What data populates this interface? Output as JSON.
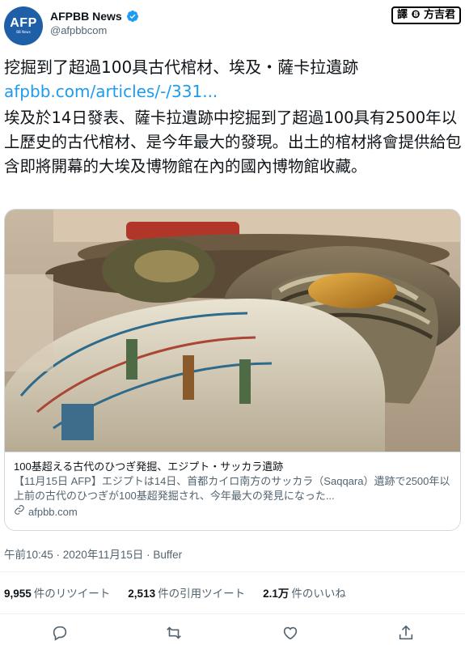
{
  "account": {
    "avatar_logo": "AFP",
    "avatar_sub": "BB News",
    "name": "AFPBB News",
    "handle": "@afpbbcom"
  },
  "badge": "譯 ❽ 方吉君",
  "tweet": {
    "title": "挖掘到了超過100具古代棺材、埃及・薩卡拉遺跡",
    "link": "afpbb.com/articles/-/331...",
    "body": "埃及於14日發表、薩卡拉遺跡中挖掘到了超過100具有2500年以上歷史的古代棺材、是今年最大的發現。出土的棺材將會提供給包含即將開幕的大埃及博物館在內的國內博物館收藏。"
  },
  "card": {
    "title": "100基超える古代のひつぎ発掘、エジプト・サッカラ遺跡",
    "description": "【11月15日 AFP】エジプトは14日、首都カイロ南方のサッカラ（Saqqara）遺跡で2500年以上前の古代のひつぎが100基超発掘され、今年最大の発見になった...",
    "domain": "afpbb.com"
  },
  "meta": "午前10:45 · 2020年11月15日 · Buffer",
  "stats": [
    {
      "count": "9,955",
      "label": "件のリツイート"
    },
    {
      "count": "2,513",
      "label": "件の引用ツイート"
    },
    {
      "count": "2.1万",
      "label": "件のいいね"
    }
  ],
  "icons": [
    "verified-icon",
    "link-icon",
    "reply-icon",
    "retweet-icon",
    "like-icon",
    "share-icon"
  ],
  "colors": {
    "link": "#1d9bf0",
    "verified": "#1d9bf0",
    "secondary_text": "#536471",
    "avatar_bg": "#1f5fa8"
  }
}
